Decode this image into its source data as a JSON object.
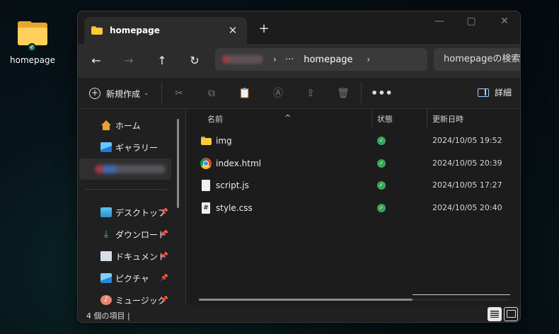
{
  "desktop": {
    "icon_label": "homepage"
  },
  "window": {
    "tab_title": "homepage",
    "tab_close": "✕",
    "new_tab": "+",
    "controls": {
      "minimize": "—",
      "maximize": "▢",
      "close": "✕"
    }
  },
  "nav": {
    "back": "←",
    "forward": "→",
    "up": "↑",
    "refresh": "↻",
    "breadcrumb_more": "···",
    "breadcrumb_current": "homepage",
    "search_placeholder": "homepageの検索"
  },
  "commandbar": {
    "new_label": "新規作成",
    "more": "•••",
    "details_label": "詳細"
  },
  "sidebar": {
    "home": "ホーム",
    "gallery": "ギャラリー",
    "quick": [
      {
        "label": "デスクトップ",
        "icon": "desktop-icon"
      },
      {
        "label": "ダウンロード",
        "icon": "download-icon"
      },
      {
        "label": "ドキュメント",
        "icon": "documents-icon"
      },
      {
        "label": "ピクチャ",
        "icon": "pictures-icon"
      },
      {
        "label": "ミュージック",
        "icon": "music-icon"
      }
    ]
  },
  "columns": {
    "name": "名前",
    "status": "状態",
    "modified": "更新日時"
  },
  "files": [
    {
      "name": "img",
      "type": "folder",
      "modified": "2024/10/05 19:52"
    },
    {
      "name": "index.html",
      "type": "chrome",
      "modified": "2024/10/05 20:39"
    },
    {
      "name": "script.js",
      "type": "js",
      "modified": "2024/10/05 17:27"
    },
    {
      "name": "style.css",
      "type": "css",
      "modified": "2024/10/05 20:40"
    }
  ],
  "statusbar": {
    "count": "4 個の項目  |"
  }
}
